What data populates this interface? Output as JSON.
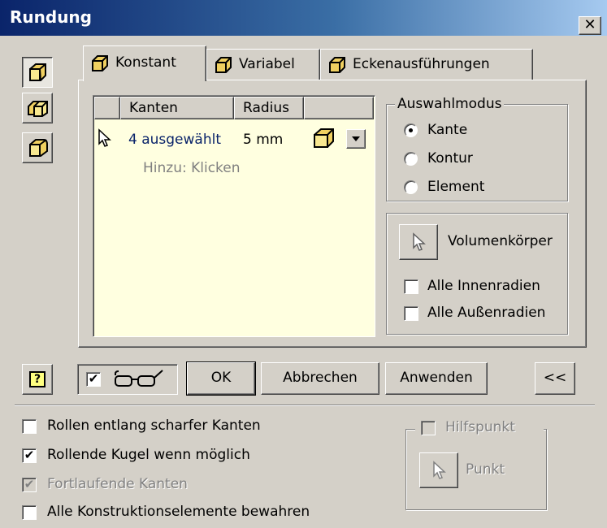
{
  "window": {
    "title": "Rundung",
    "close_label": "✕"
  },
  "side_buttons": [
    {
      "name": "edge-fillet-mode",
      "icon": "cube-edge-fillet-icon"
    },
    {
      "name": "face-fillet-mode",
      "icon": "face-fillet-icon"
    },
    {
      "name": "full-round-fillet-mode",
      "icon": "full-round-fillet-icon"
    }
  ],
  "tabs": [
    {
      "label": "Konstant",
      "icon": "cube-constant-icon",
      "active": true
    },
    {
      "label": "Variabel",
      "icon": "cube-variable-icon",
      "active": false
    },
    {
      "label": "Eckenausführungen",
      "icon": "cube-corner-icon",
      "active": false
    }
  ],
  "table": {
    "headers": {
      "edges": "Kanten",
      "radius": "Radius"
    },
    "row": {
      "edges": "4 ausgewählt",
      "radius": "5 mm"
    },
    "add_hint": "Hinzu: Klicken"
  },
  "selection_mode": {
    "label": "Auswahlmodus",
    "options": [
      "Kante",
      "Kontur",
      "Element"
    ],
    "selected": "Kante"
  },
  "solid": {
    "button_label": "Volumenkörper",
    "all_inner": "Alle Innenradien",
    "all_outer": "Alle Außenradien"
  },
  "actions": {
    "help": "?",
    "preview_checked": true,
    "ok": "OK",
    "cancel": "Abbrechen",
    "apply": "Anwenden",
    "collapse": "<<"
  },
  "options": {
    "roll_sharp": "Rollen entlang scharfer Kanten",
    "rolling_ball": "Rollende Kugel wenn möglich",
    "continuous": "Fortlaufende Kanten",
    "preserve_all": "Alle Konstruktionselemente bewahren",
    "roll_sharp_checked": false,
    "rolling_ball_checked": true,
    "continuous_checked": true,
    "preserve_all_checked": false
  },
  "help_point": {
    "label": "Hilfspunkt",
    "button_label": "Punkt"
  },
  "colors": {
    "title_start": "#0a246a",
    "title_end": "#a6caf0",
    "list_background": "#ffffe0",
    "selected_text": "#0a246a",
    "cube_face": "#f0d060"
  }
}
